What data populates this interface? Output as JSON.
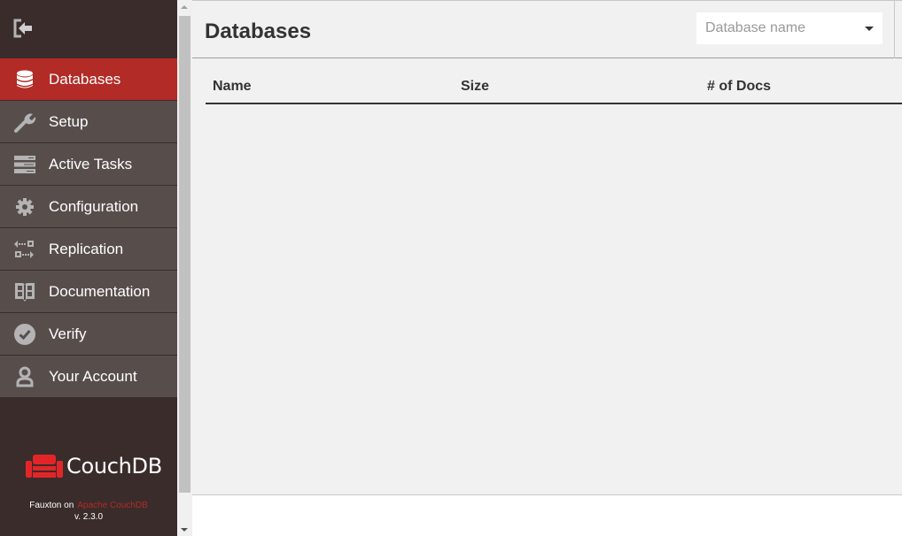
{
  "sidebar": {
    "collapse_icon": "sign-out-icon",
    "items": [
      {
        "label": "Databases",
        "icon": "database-icon",
        "active": true
      },
      {
        "label": "Setup",
        "icon": "wrench-icon",
        "active": false
      },
      {
        "label": "Active Tasks",
        "icon": "server-icon",
        "active": false
      },
      {
        "label": "Configuration",
        "icon": "gear-icon",
        "active": false
      },
      {
        "label": "Replication",
        "icon": "replication-icon",
        "active": false
      },
      {
        "label": "Documentation",
        "icon": "book-icon",
        "active": false
      },
      {
        "label": "Verify",
        "icon": "check-circle-icon",
        "active": false
      },
      {
        "label": "Your Account",
        "icon": "user-icon",
        "active": false
      }
    ],
    "logo_text": "CouchDB",
    "footer": {
      "prefix": "Fauxton on",
      "link": "Apache CouchDB",
      "version": "v. 2.3.0"
    }
  },
  "header": {
    "title": "Databases",
    "db_select_placeholder": "Database name"
  },
  "table": {
    "columns": [
      "Name",
      "Size",
      "# of Docs"
    ],
    "rows": []
  },
  "colors": {
    "sidebar_bg": "#3a2c2b",
    "nav_item_bg": "#574e4c",
    "accent": "#b22b26",
    "main_bg": "#f1f1f1"
  }
}
